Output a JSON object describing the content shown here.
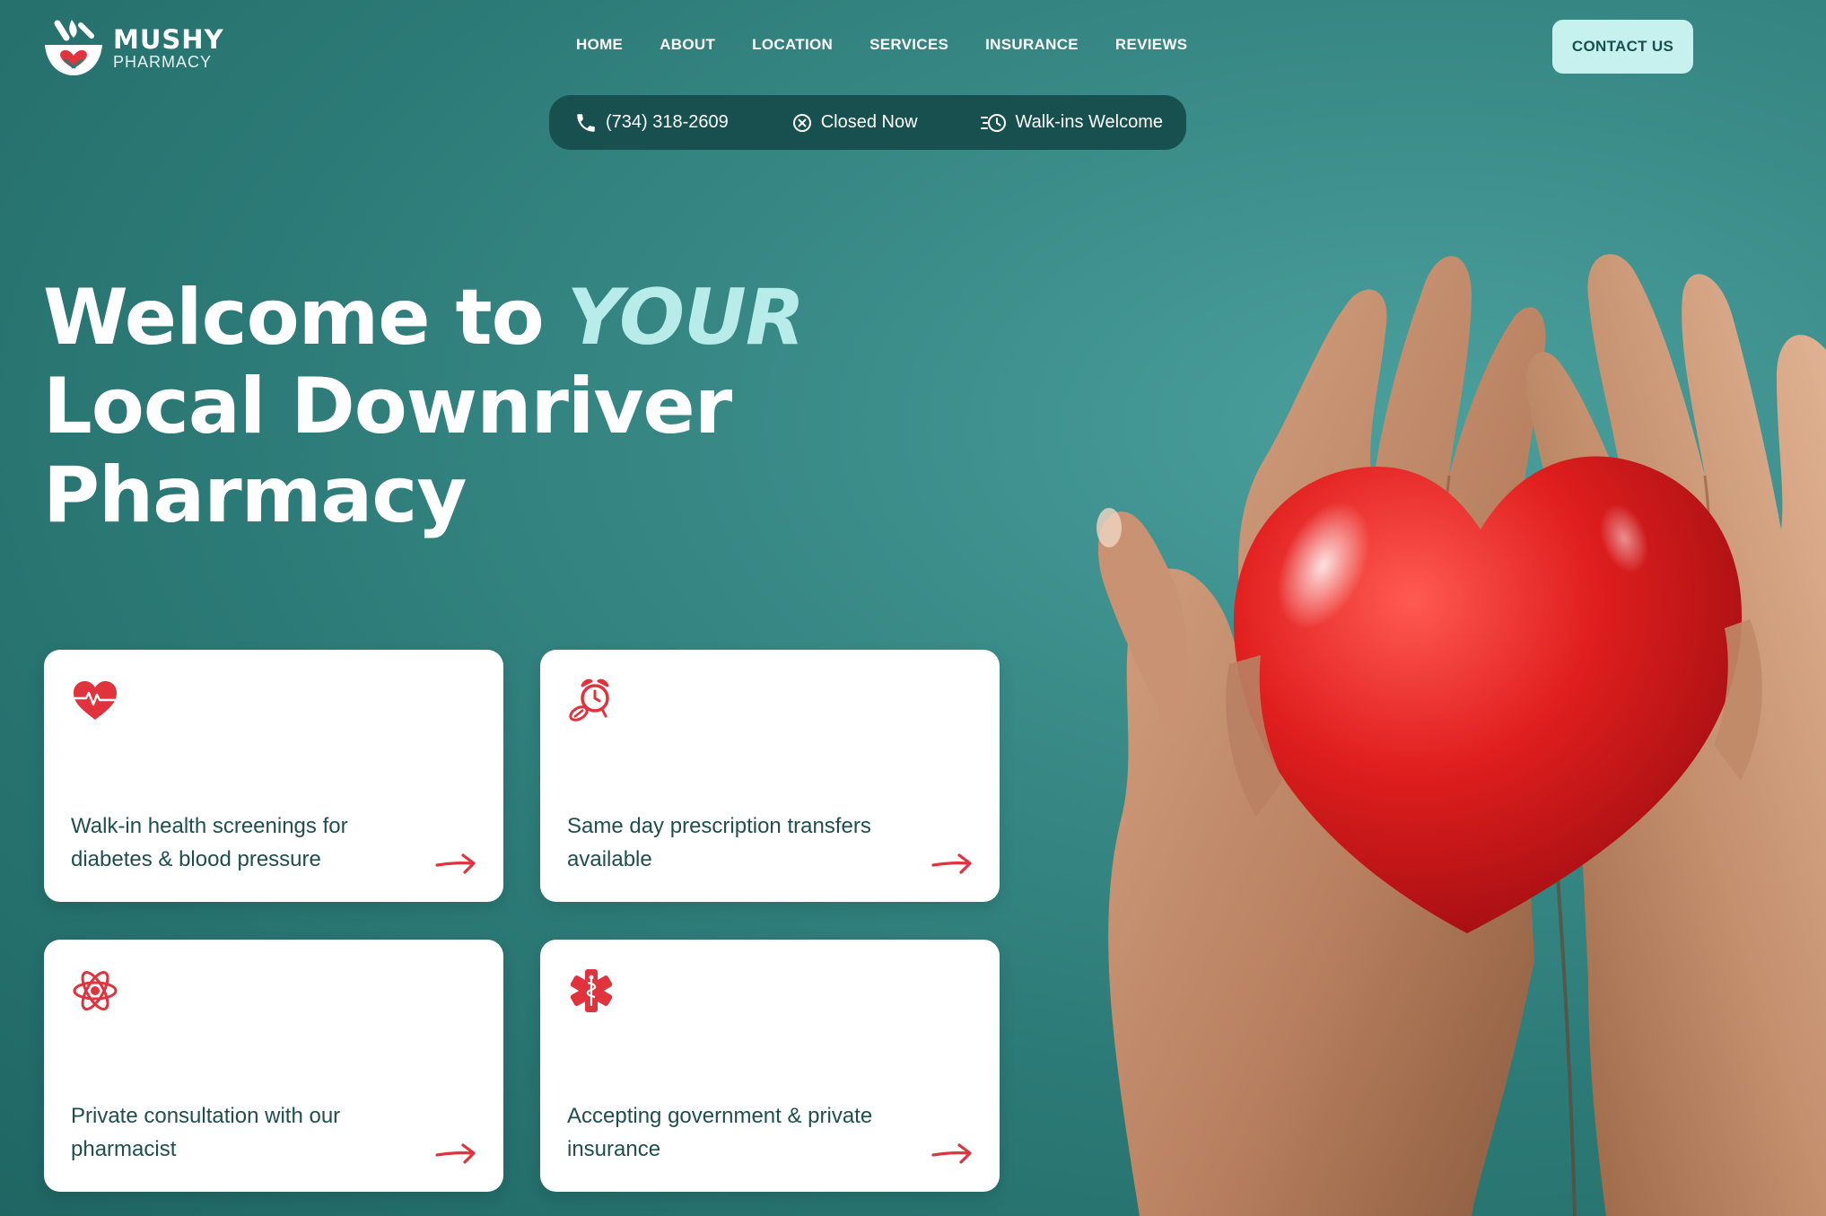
{
  "logo": {
    "name": "MUSHY",
    "subtitle": "PHARMACY"
  },
  "nav": {
    "items": [
      "HOME",
      "ABOUT",
      "LOCATION",
      "SERVICES",
      "INSURANCE",
      "REVIEWS"
    ]
  },
  "header": {
    "contact_label": "CONTACT US"
  },
  "info_bar": {
    "phone": "(734) 318-2609",
    "status": "Closed Now",
    "walkins": "Walk-ins Welcome"
  },
  "hero": {
    "title_line1": "Welcome to",
    "title_accent": "YOUR",
    "title_line2": "Local Downriver",
    "title_line3": "Pharmacy"
  },
  "cards": [
    {
      "icon": "heart-pulse-icon",
      "text": "Walk-in health screenings for diabetes & blood pressure"
    },
    {
      "icon": "alarm-clock-pill-icon",
      "text": "Same day prescription transfers available"
    },
    {
      "icon": "atom-icon",
      "text": "Private consultation with our pharmacist"
    },
    {
      "icon": "medical-star-icon",
      "text": "Accepting government & private insurance"
    }
  ],
  "colors": {
    "background": "#2c7a77",
    "accent_text": "#b7ecea",
    "contact_button": "#c6f1ef",
    "info_bar": "#17504e",
    "icon_red": "#e0333d",
    "card_text": "#1e4f4c"
  }
}
